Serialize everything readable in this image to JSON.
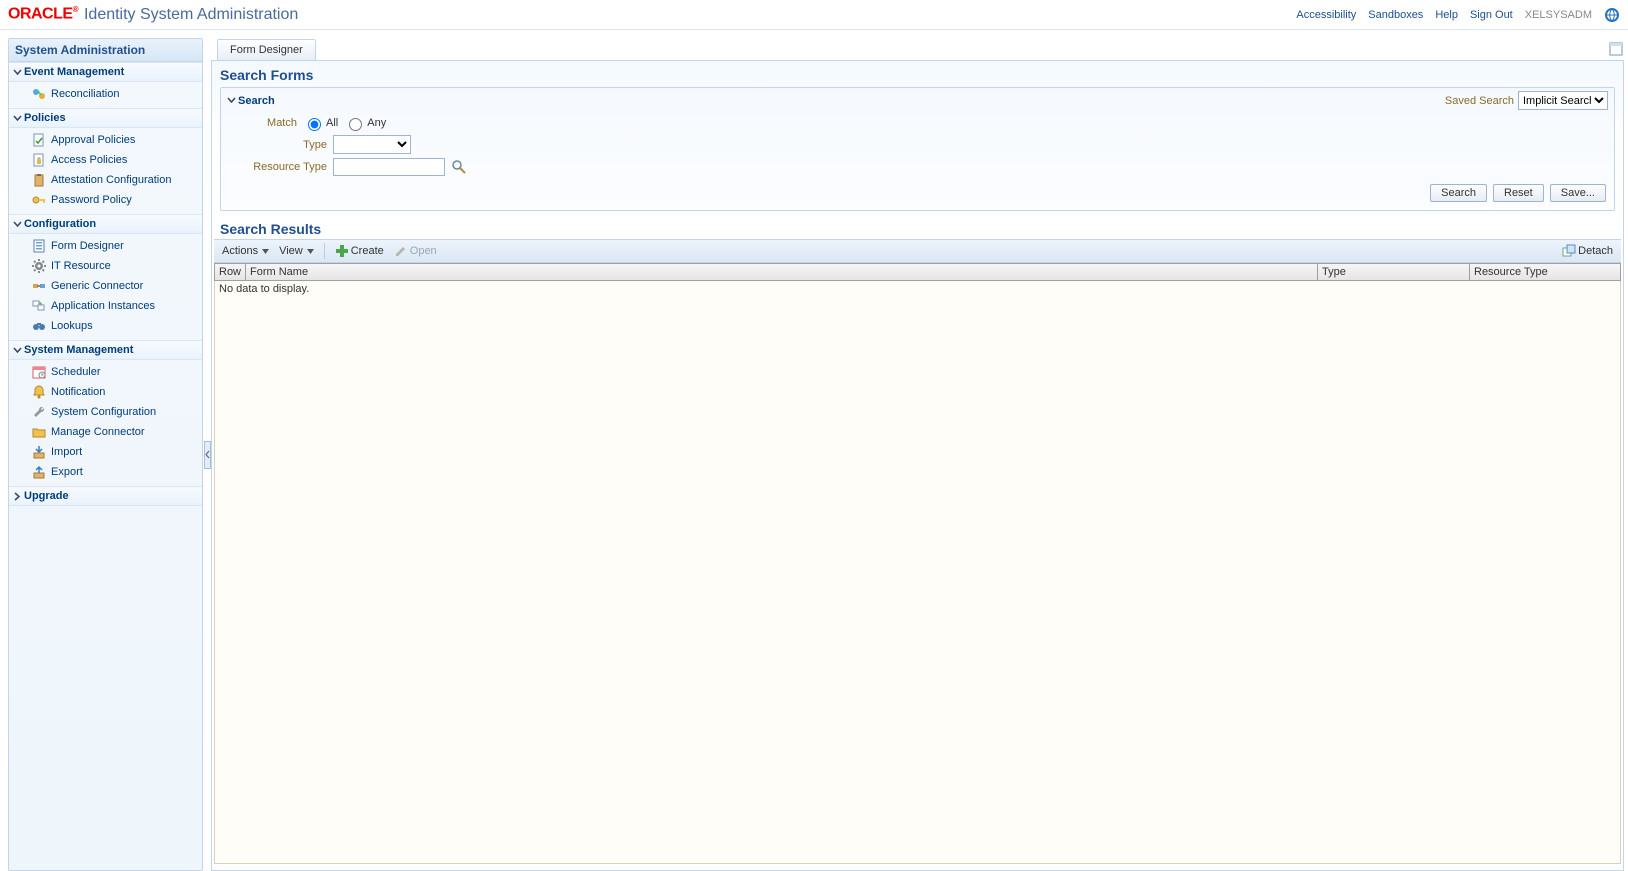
{
  "header": {
    "brand": "ORACLE",
    "app_title": "Identity System Administration",
    "links": {
      "accessibility": "Accessibility",
      "sandboxes": "Sandboxes",
      "help": "Help",
      "signout": "Sign Out"
    },
    "user": "XELSYSADM"
  },
  "sidebar": {
    "title": "System Administration",
    "groups": [
      {
        "label": "Event Management",
        "expanded": true,
        "items": [
          {
            "label": "Reconciliation"
          }
        ]
      },
      {
        "label": "Policies",
        "expanded": true,
        "items": [
          {
            "label": "Approval Policies"
          },
          {
            "label": "Access Policies"
          },
          {
            "label": "Attestation Configuration"
          },
          {
            "label": "Password Policy"
          }
        ]
      },
      {
        "label": "Configuration",
        "expanded": true,
        "items": [
          {
            "label": "Form Designer"
          },
          {
            "label": "IT Resource"
          },
          {
            "label": "Generic Connector"
          },
          {
            "label": "Application Instances"
          },
          {
            "label": "Lookups"
          }
        ]
      },
      {
        "label": "System Management",
        "expanded": true,
        "items": [
          {
            "label": "Scheduler"
          },
          {
            "label": "Notification"
          },
          {
            "label": "System Configuration"
          },
          {
            "label": "Manage Connector"
          },
          {
            "label": "Import"
          },
          {
            "label": "Export"
          }
        ]
      },
      {
        "label": "Upgrade",
        "expanded": false,
        "items": []
      }
    ]
  },
  "tabs": {
    "active": "Form Designer"
  },
  "page": {
    "title": "Search Forms",
    "search_section": "Search",
    "saved_search_label": "Saved Search",
    "saved_search_selected": "Implicit Search",
    "match_label": "Match",
    "match_all": "All",
    "match_any": "Any",
    "type_label": "Type",
    "type_value": "",
    "resource_type_label": "Resource Type",
    "resource_type_value": "",
    "buttons": {
      "search": "Search",
      "reset": "Reset",
      "save": "Save..."
    },
    "results_title": "Search Results",
    "toolbar": {
      "actions": "Actions",
      "view": "View",
      "create": "Create",
      "open": "Open",
      "detach": "Detach"
    },
    "columns": {
      "row": "Row",
      "form_name": "Form Name",
      "type": "Type",
      "resource_type": "Resource Type"
    },
    "empty": "No data to display."
  }
}
